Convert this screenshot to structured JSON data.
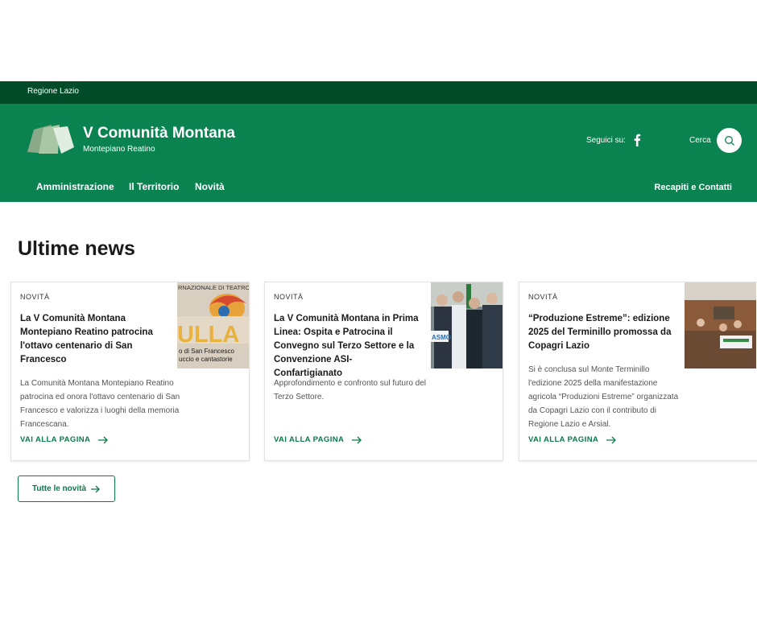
{
  "topbar": {
    "label": "Regione Lazio"
  },
  "header": {
    "title": "V Comunità Montana",
    "subtitle": "Montepiano Reatino",
    "social_label": "Seguici su:",
    "search_label": "Cerca",
    "nav": [
      "Amministrazione",
      "Il Territorio",
      "Novità"
    ],
    "contacts": "Recapiti e Contatti"
  },
  "news": {
    "title": "Ultime news",
    "cards": [
      {
        "category": "NOVITÀ",
        "title": "La V Comunità Montana Montepiano Reatino patrocina l'ottavo centenario di San Francesco",
        "text": "La Comunità Montana Montepiano Reatino patrocina ed onora l'ottavo centenario di San Francesco e valorizza i luoghi della memoria Francescana.",
        "link": "VAI ALLA PAGINA",
        "image_text": [
          "RNAZIONALE DI TEATRO",
          "ULLA",
          "o di San Francesco",
          "uccio e cantastorie"
        ]
      },
      {
        "category": "NOVITÀ",
        "title": "La V Comunità Montana in Prima Linea: Ospita e Patrocina il Convegno sul Terzo Settore e la Convenzione ASI-Confartigianato",
        "text": "Approfondimento e confronto sul futuro del Terzo Settore.",
        "link": "VAI ALLA PAGINA",
        "image_text": [
          "ASMO"
        ]
      },
      {
        "category": "NOVITÀ",
        "title": "“Produzione Estreme”: edizione 2025 del Terminillo promossa da Copagri Lazio",
        "text": "Si è conclusa sul Monte Terminillo l'edizione 2025 della manifestazione agricola “Produzioni Estreme” organizzata da Copagri Lazio con il contributo di Regione Lazio e Arsial.",
        "link": "VAI ALLA PAGINA",
        "image_text": []
      }
    ],
    "all_button": "Tutte le novità"
  },
  "colors": {
    "dark_green": "#034c2a",
    "brand_green": "#0a8350",
    "link_green": "#0a7a47"
  }
}
